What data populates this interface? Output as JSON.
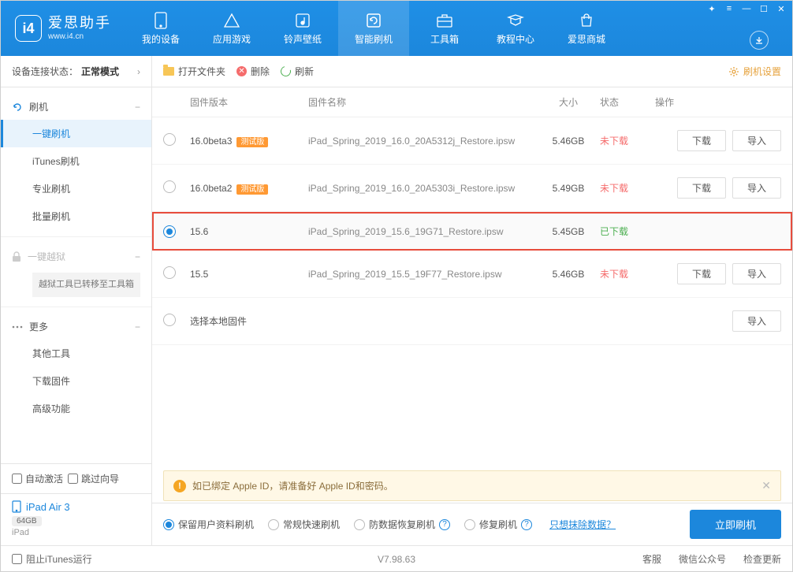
{
  "app": {
    "name": "爱思助手",
    "url": "www.i4.cn"
  },
  "nav": [
    {
      "label": "我的设备"
    },
    {
      "label": "应用游戏"
    },
    {
      "label": "铃声壁纸"
    },
    {
      "label": "智能刷机"
    },
    {
      "label": "工具箱"
    },
    {
      "label": "教程中心"
    },
    {
      "label": "爱思商城"
    }
  ],
  "status": {
    "label": "设备连接状态：",
    "value": "正常模式"
  },
  "sidebar": {
    "flash_head": "刷机",
    "items": [
      "一键刷机",
      "iTunes刷机",
      "专业刷机",
      "批量刷机"
    ],
    "jailbreak": "一键越狱",
    "jb_note": "越狱工具已转移至工具箱",
    "more": "更多",
    "more_items": [
      "其他工具",
      "下载固件",
      "高级功能"
    ]
  },
  "bottom": {
    "auto_activate": "自动激活",
    "skip_guide": "跳过向导",
    "device_name": "iPad Air 3",
    "capacity": "64GB",
    "device_type": "iPad"
  },
  "toolbar": {
    "open": "打开文件夹",
    "delete": "删除",
    "refresh": "刷新",
    "settings": "刷机设置"
  },
  "columns": {
    "ver": "固件版本",
    "name": "固件名称",
    "size": "大小",
    "status": "状态",
    "ops": "操作"
  },
  "rows": [
    {
      "ver": "16.0beta3",
      "beta": "测试版",
      "name": "iPad_Spring_2019_16.0_20A5312j_Restore.ipsw",
      "size": "5.46GB",
      "status": "未下载",
      "downloaded": false,
      "selected": false
    },
    {
      "ver": "16.0beta2",
      "beta": "测试版",
      "name": "iPad_Spring_2019_16.0_20A5303i_Restore.ipsw",
      "size": "5.49GB",
      "status": "未下载",
      "downloaded": false,
      "selected": false
    },
    {
      "ver": "15.6",
      "beta": "",
      "name": "iPad_Spring_2019_15.6_19G71_Restore.ipsw",
      "size": "5.45GB",
      "status": "已下载",
      "downloaded": true,
      "selected": true
    },
    {
      "ver": "15.5",
      "beta": "",
      "name": "iPad_Spring_2019_15.5_19F77_Restore.ipsw",
      "size": "5.46GB",
      "status": "未下载",
      "downloaded": false,
      "selected": false
    }
  ],
  "local_row": "选择本地固件",
  "ops": {
    "download": "下载",
    "import": "导入"
  },
  "notice": "如已绑定 Apple ID，请准备好 Apple ID和密码。",
  "flash_opts": {
    "keep": "保留用户资料刷机",
    "normal": "常规快速刷机",
    "recover": "防数据恢复刷机",
    "fix": "修复刷机",
    "erase": "只想抹除数据？",
    "go": "立即刷机"
  },
  "footer": {
    "block": "阻止iTunes运行",
    "version": "V7.98.63",
    "service": "客服",
    "wechat": "微信公众号",
    "update": "检查更新"
  }
}
